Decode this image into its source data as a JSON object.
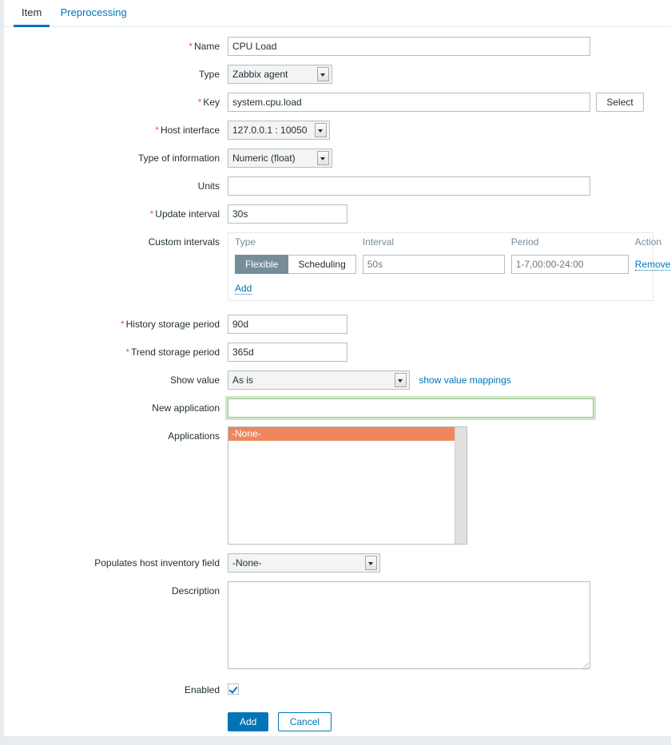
{
  "tabs": [
    {
      "label": "Item",
      "active": true
    },
    {
      "label": "Preprocessing",
      "active": false
    }
  ],
  "form": {
    "name": {
      "label": "Name",
      "required": true,
      "value": "CPU Load"
    },
    "type": {
      "label": "Type",
      "required": false,
      "value": "Zabbix agent"
    },
    "key": {
      "label": "Key",
      "required": true,
      "value": "system.cpu.load",
      "select_button": "Select"
    },
    "host_interface": {
      "label": "Host interface",
      "required": true,
      "value": "127.0.0.1 : 10050"
    },
    "type_of_information": {
      "label": "Type of information",
      "required": false,
      "value": "Numeric (float)"
    },
    "units": {
      "label": "Units",
      "required": false,
      "value": ""
    },
    "update_interval": {
      "label": "Update interval",
      "required": true,
      "value": "30s"
    },
    "custom_intervals": {
      "label": "Custom intervals",
      "columns": [
        "Type",
        "Interval",
        "Period",
        "Action"
      ],
      "rows": [
        {
          "type_options": [
            "Flexible",
            "Scheduling"
          ],
          "type_selected": "Flexible",
          "interval_placeholder": "50s",
          "interval_value": "",
          "period_placeholder": "1-7,00:00-24:00",
          "period_value": "",
          "action_label": "Remove"
        }
      ],
      "add_label": "Add"
    },
    "history_storage_period": {
      "label": "History storage period",
      "required": true,
      "value": "90d"
    },
    "trend_storage_period": {
      "label": "Trend storage period",
      "required": true,
      "value": "365d"
    },
    "show_value": {
      "label": "Show value",
      "required": false,
      "value": "As is",
      "link_label": "show value mappings"
    },
    "new_application": {
      "label": "New application",
      "required": false,
      "value": "",
      "focused": true
    },
    "applications": {
      "label": "Applications",
      "options": [
        "-None-"
      ],
      "selected": "-None-"
    },
    "populates_host_inventory_field": {
      "label": "Populates host inventory field",
      "required": false,
      "value": "-None-"
    },
    "description": {
      "label": "Description",
      "required": false,
      "value": ""
    },
    "enabled": {
      "label": "Enabled",
      "checked": true
    }
  },
  "footer": {
    "submit_label": "Add",
    "cancel_label": "Cancel"
  },
  "colors": {
    "accent": "#0275b8",
    "required": "#e45959",
    "selected_option": "#f0865c",
    "toggle_active": "#768d99",
    "focus_ring": "#cfe6c6",
    "panel_bg": "#ffffff",
    "page_bg": "#e8ecee"
  }
}
